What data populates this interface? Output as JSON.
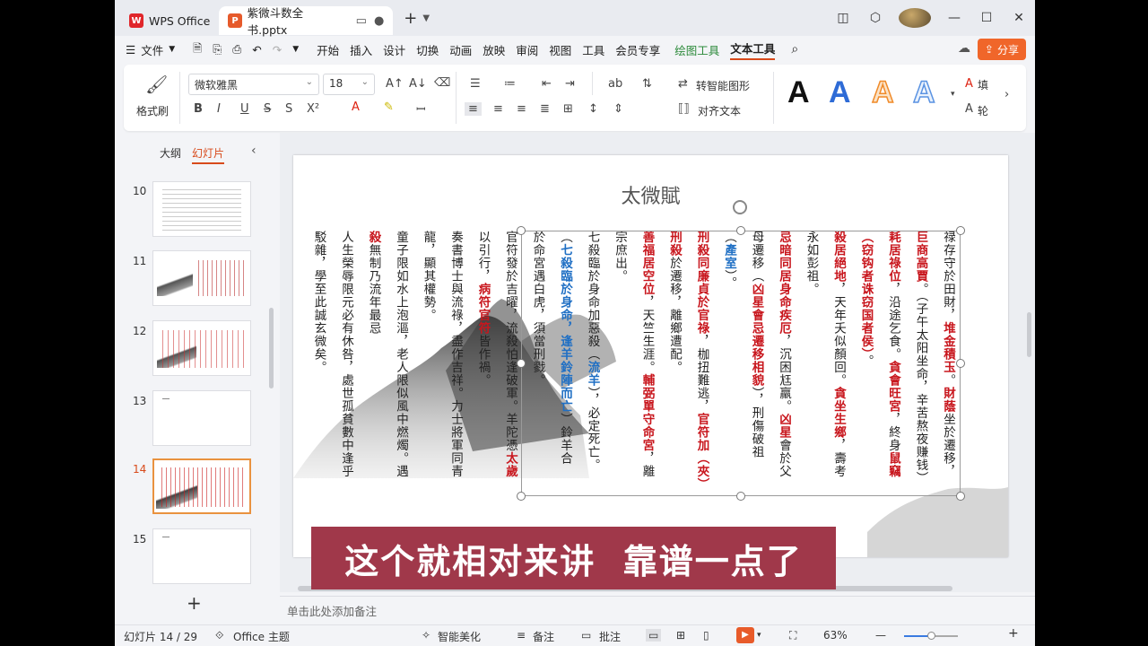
{
  "titlebar": {
    "app_tab": "WPS Office",
    "doc_tab": "紫微斗数全书.pptx",
    "new_tab": "+"
  },
  "menubar": {
    "file": "文件",
    "items": [
      "开始",
      "插入",
      "设计",
      "切换",
      "动画",
      "放映",
      "审阅",
      "视图",
      "工具",
      "会员专享"
    ],
    "drawing_tools": "绘图工具",
    "text_tools": "文本工具",
    "share": "分享"
  },
  "ribbon": {
    "format_painter": "格式刷",
    "font_name": "微软雅黑",
    "font_size": "18",
    "smart_shape": "转智能图形",
    "align_text": "对齐文本",
    "text_fill_label": "填",
    "text_outline_label": "轮"
  },
  "leftpanel": {
    "outline_tab": "大纲",
    "slides_tab": "幻灯片",
    "slides": [
      {
        "num": "10"
      },
      {
        "num": "11"
      },
      {
        "num": "12"
      },
      {
        "num": "13"
      },
      {
        "num": "14"
      },
      {
        "num": "15"
      }
    ],
    "add": "+"
  },
  "slide": {
    "title": "太微賦",
    "columns": [
      [
        {
          "t": "禄存守於田財，"
        },
        {
          "t": "堆金積玉",
          "c": "r"
        },
        {
          "t": "。"
        },
        {
          "t": "財蔭",
          "c": "r"
        },
        {
          "t": "坐於遷移，"
        }
      ],
      [
        {
          "t": "巨商高賈",
          "c": "r"
        },
        {
          "t": "。（子午太阳坐命，辛苦熬夜赚钱）"
        }
      ],
      [
        {
          "t": "耗居祿位",
          "c": "r"
        },
        {
          "t": "，沿途乞食。"
        },
        {
          "t": "貪會旺宮",
          "c": "r"
        },
        {
          "t": "，終身"
        },
        {
          "t": "鼠竊",
          "c": "r"
        }
      ],
      [
        {
          "t": "（窃钩者诛窃国者侯）",
          "c": "r"
        },
        {
          "t": "。"
        }
      ],
      [
        {
          "t": "殺居絕地",
          "c": "r"
        },
        {
          "t": "，天年夭似顏回。"
        },
        {
          "t": "貪坐生鄉",
          "c": "r"
        },
        {
          "t": "，壽考"
        }
      ],
      [
        {
          "t": "永如彭祖。"
        }
      ],
      [
        {
          "t": "忌暗同居身命疾厄",
          "c": "r"
        },
        {
          "t": "，沉困尪羸。"
        },
        {
          "t": "凶星",
          "c": "r"
        },
        {
          "t": "會於父"
        }
      ],
      [
        {
          "t": "母遷移（"
        },
        {
          "t": "凶星會忌遷移相貌",
          "c": "r"
        },
        {
          "t": "），刑傷破祖"
        }
      ],
      [
        {
          "t": "（"
        },
        {
          "t": "產室",
          "c": "b"
        },
        {
          "t": "）。"
        }
      ],
      [
        {
          "t": "刑殺同廉貞於官祿",
          "c": "r"
        },
        {
          "t": "，枷扭難逃，"
        },
        {
          "t": "官符加（夾）",
          "c": "r"
        }
      ],
      [
        {
          "t": "刑殺",
          "c": "r"
        },
        {
          "t": "於遷移，離鄉遭配。"
        }
      ],
      [
        {
          "t": "善福居空位",
          "c": "r"
        },
        {
          "t": "，天竺生涯。"
        },
        {
          "t": "輔弼單守命宮",
          "c": "r"
        },
        {
          "t": "，離"
        }
      ],
      [
        {
          "t": "宗庶出。"
        }
      ],
      [
        {
          "t": "七殺臨於身命加惡殺（"
        },
        {
          "t": "流羊",
          "c": "b"
        },
        {
          "t": "），必定死亡。"
        }
      ],
      [
        {
          "t": "（"
        },
        {
          "t": "七殺臨於身命，逢羊鈴陣而亡",
          "c": "b"
        },
        {
          "t": "）鈴羊合"
        }
      ],
      [
        {
          "t": "於命宮遇白虎，須當刑戮。"
        }
      ],
      [
        {
          "t": "官符發於吉曜，流殺怕逢破軍。羊陀憑"
        },
        {
          "t": "太歲",
          "c": "r"
        }
      ],
      [
        {
          "t": "以引行，"
        },
        {
          "t": "病符官符",
          "c": "r"
        },
        {
          "t": "皆作禍。"
        }
      ],
      [
        {
          "t": "奏書博士與流祿，盡作吉祥。力士將軍同青"
        }
      ],
      [
        {
          "t": "龍，顯其權勢。"
        }
      ],
      [
        {
          "t": "童子限如水上泡漚，老人限似風中燃燭。遇"
        }
      ],
      [
        {
          "t": "殺",
          "c": "r"
        },
        {
          "t": "無制乃流年最忌"
        }
      ],
      [
        {
          "t": "人生榮辱限元必有休咎，處世孤貧數中逢乎"
        }
      ],
      [
        {
          "t": "駁雜，學至此誠玄微矣。"
        }
      ]
    ]
  },
  "notes_placeholder": "单击此处添加备注",
  "subtitle": "这个就相对来讲  靠谱一点了",
  "statusbar": {
    "slide_counter": "幻灯片 14 / 29",
    "theme": "Office 主题",
    "smart_beautify": "智能美化",
    "notes": "备注",
    "comments": "批注",
    "zoom": "63%",
    "zoom_fraction": 0.63
  }
}
